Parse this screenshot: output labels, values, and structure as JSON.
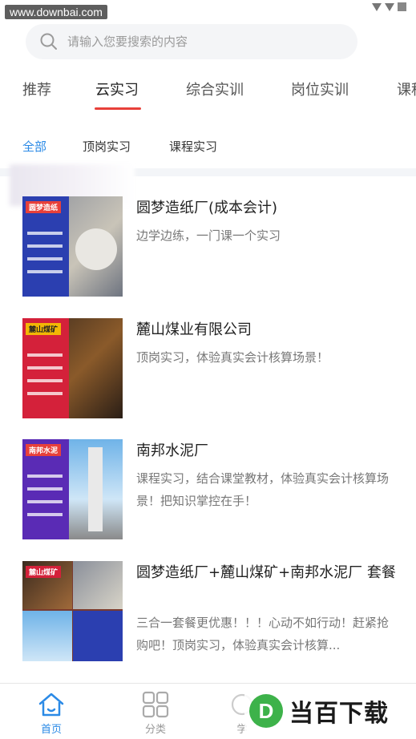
{
  "watermark": "www.downbai.com",
  "search": {
    "placeholder": "请输入您要搜索的内容"
  },
  "tabs": [
    {
      "label": "推荐"
    },
    {
      "label": "云实习"
    },
    {
      "label": "综合实训"
    },
    {
      "label": "岗位实训"
    },
    {
      "label": "课程"
    }
  ],
  "subtabs": [
    {
      "label": "全部"
    },
    {
      "label": "顶岗实习"
    },
    {
      "label": "课程实习"
    }
  ],
  "items": [
    {
      "title": "圆梦造纸厂(成本会计)",
      "desc": "边学边练，一门课一个实习",
      "thumb_tag": "圆梦造纸",
      "thumb_color": "#2b3fb0"
    },
    {
      "title": "麓山煤业有限公司",
      "desc": "顶岗实习，体验真实会计核算场景！",
      "thumb_tag": "麓山煤矿",
      "thumb_color": "#d4213a"
    },
    {
      "title": "南邦水泥厂",
      "desc": "课程实习，结合课堂教材，体验真实会计核算场景！把知识掌控在手！",
      "thumb_tag": "南邦水泥",
      "thumb_color": "#5a2bb5"
    },
    {
      "title": "圆梦造纸厂+麓山煤矿+南邦水泥厂 套餐",
      "desc": "三合一套餐更优惠！！！心动不如行动！赶紧抢购吧！顶岗实习，体验真实会计核算...",
      "thumb_tag": "麓山煤矿",
      "thumb_color": "#c0202e"
    }
  ],
  "bottom_nav": [
    {
      "label": "首页",
      "icon": "home-icon"
    },
    {
      "label": "分类",
      "icon": "grid-icon"
    },
    {
      "label": "学",
      "icon": "study-icon"
    }
  ],
  "brand_watermark": {
    "logo": "D",
    "text": "当百下载"
  },
  "colors": {
    "accent": "#e8403a",
    "link": "#2b8ae6"
  }
}
